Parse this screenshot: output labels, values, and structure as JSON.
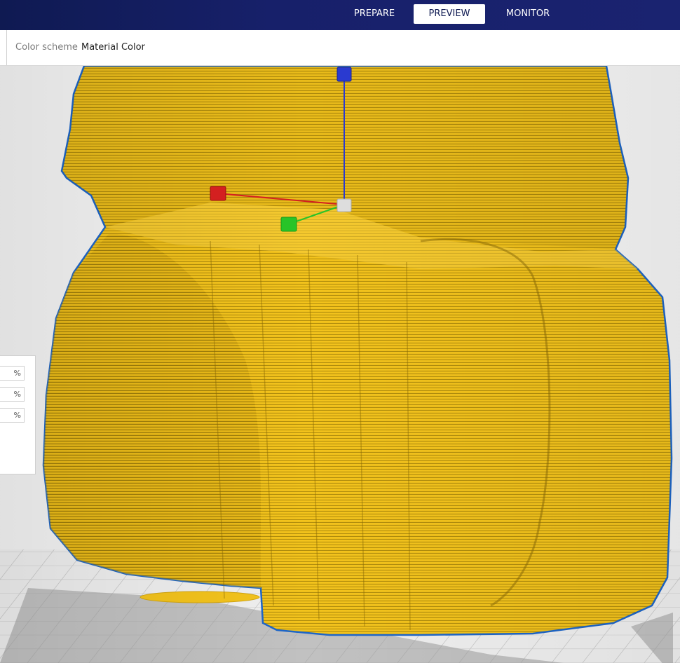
{
  "stages": {
    "prepare": "PREPARE",
    "preview": "PREVIEW",
    "monitor": "MONITOR"
  },
  "view_settings": {
    "color_scheme_label": "Color scheme",
    "color_scheme_value": "Material Color"
  },
  "side_panel": {
    "fields": [
      {
        "unit": "%"
      },
      {
        "unit": "%"
      },
      {
        "unit": "%"
      }
    ]
  },
  "colors": {
    "header_bg": "#17206a",
    "model_fill": "#f2c41d",
    "model_outline": "#1e66c8",
    "axis_x": "#d42020",
    "axis_y": "#2a3ad0",
    "axis_z": "#28c428"
  }
}
